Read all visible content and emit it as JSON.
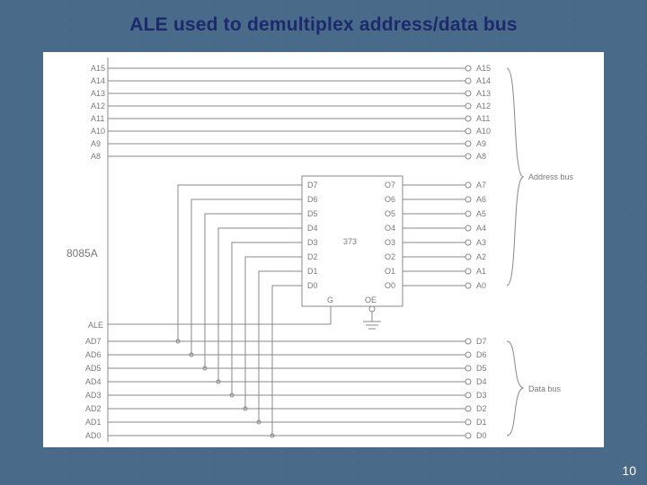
{
  "title": "ALE used to demultiplex address/data bus",
  "page_number": "10",
  "processor_label": "8085A",
  "ale_label": "ALE",
  "latch": {
    "name": "373",
    "inputs": [
      "D7",
      "D6",
      "D5",
      "D4",
      "D3",
      "D2",
      "D1",
      "D0"
    ],
    "outputs": [
      "O7",
      "O6",
      "O5",
      "O4",
      "O3",
      "O2",
      "O1",
      "O0"
    ],
    "enable_g": "G",
    "enable_oe": "OE"
  },
  "address_high": {
    "left": [
      "A15",
      "A14",
      "A13",
      "A12",
      "A11",
      "A10",
      "A9",
      "A8"
    ],
    "right": [
      "A15",
      "A14",
      "A13",
      "A12",
      "A11",
      "A10",
      "A9",
      "A8"
    ]
  },
  "address_low_right": [
    "A7",
    "A6",
    "A5",
    "A4",
    "A3",
    "A2",
    "A1",
    "A0"
  ],
  "ad_bus": {
    "left": [
      "AD7",
      "AD6",
      "AD5",
      "AD4",
      "AD3",
      "AD2",
      "AD1",
      "AD0"
    ],
    "right": [
      "D7",
      "D6",
      "D5",
      "D4",
      "D3",
      "D2",
      "D1",
      "D0"
    ]
  },
  "bus_labels": {
    "address": "Address bus",
    "data": "Data bus"
  }
}
